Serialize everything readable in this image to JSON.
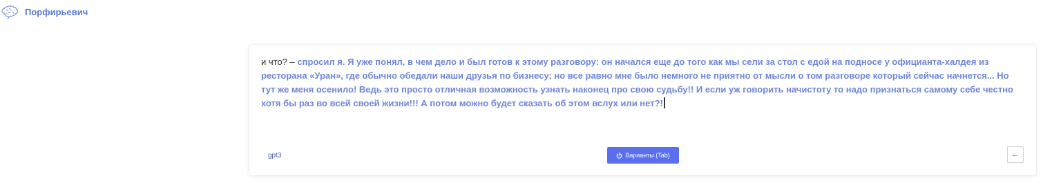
{
  "header": {
    "logo_icon": "brain-icon",
    "title": "Порфирьевич"
  },
  "editor": {
    "user_text": "и что? –",
    "generated_text": " спросил я. Я уже понял, в чем дело и был готов к этому разговору: он начался еще до того как мы сели за стол с едой на подносе у официанта-халдея из ресторана «Уран», где обычно обедали наши друзья по бизнесу; но все равно мне было немного не приятно от мысли о том разговоре который сейчас начнется... Но тут же меня осенило! Ведь это просто отличная возможность узнать наконец про свою судьбу!! И если уж говорить начистоту то надо признаться самому себе честно хотя бы раз во всей своей жизни!!! А потом можно будет сказать об этом вслух или нет?!"
  },
  "footer": {
    "model": "gpt3",
    "variants_label": "Варианты (Tab)",
    "variants_icon": "power-icon",
    "back_icon": "arrow-left-icon",
    "back_glyph": "←"
  },
  "colors": {
    "accent": "#5a6ff0",
    "generated_text": "#6f86d9",
    "title": "#5b78d6"
  }
}
